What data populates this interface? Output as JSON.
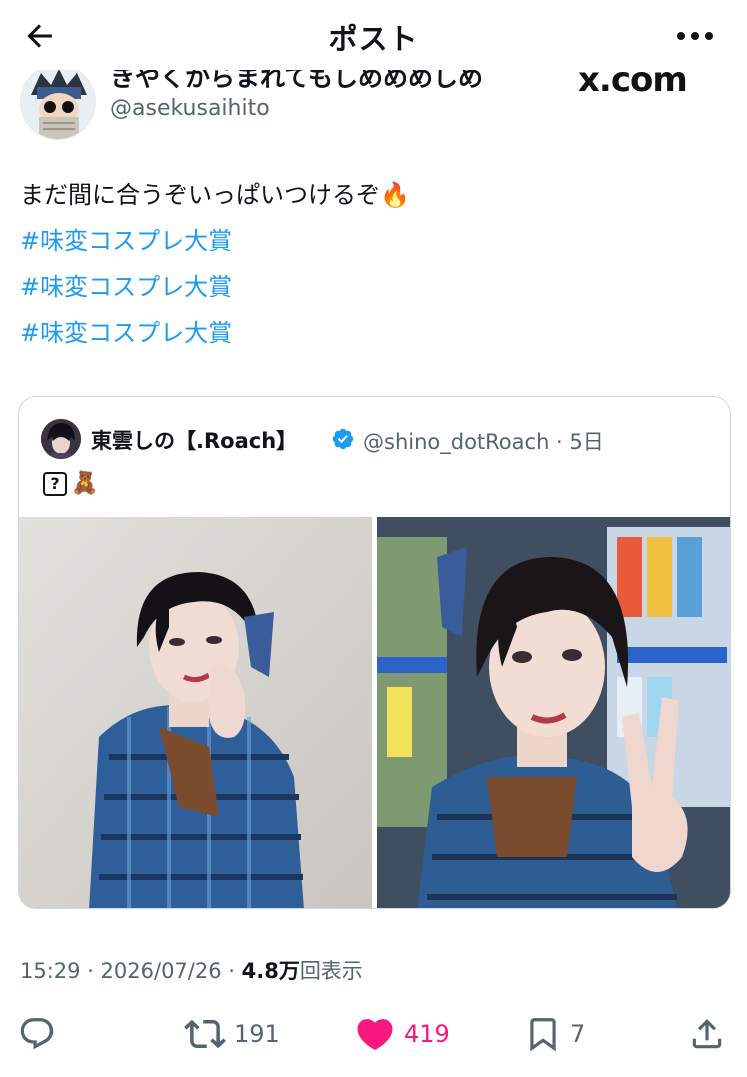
{
  "header": {
    "title": "ポスト"
  },
  "author": {
    "display_name": "きやくからまれてもしめめめしめ",
    "handle": "@asekusaihito"
  },
  "watermark": "x.com",
  "tweet": {
    "line1": "まだ間に合うぞいっぱいつけるぞ🔥",
    "hashtags": [
      "#味変コスプレ大賞",
      "#味変コスプレ大賞",
      "#味変コスプレ大賞"
    ]
  },
  "quote": {
    "display_name": "東雲しの【.Roach】",
    "handle_time": "@shino_dotRoach · 5日",
    "text_box": "?",
    "text_emoji": "🧸"
  },
  "meta": {
    "time": "15:29 · 2026/07/26 · ",
    "views_number": "4.8万",
    "views_label": "回表示"
  },
  "actions": {
    "retweets": "191",
    "likes": "419",
    "bookmarks": "7"
  },
  "colors": {
    "accent": "#1d9bf0",
    "like": "#f91880",
    "secondary_text": "#536471"
  }
}
